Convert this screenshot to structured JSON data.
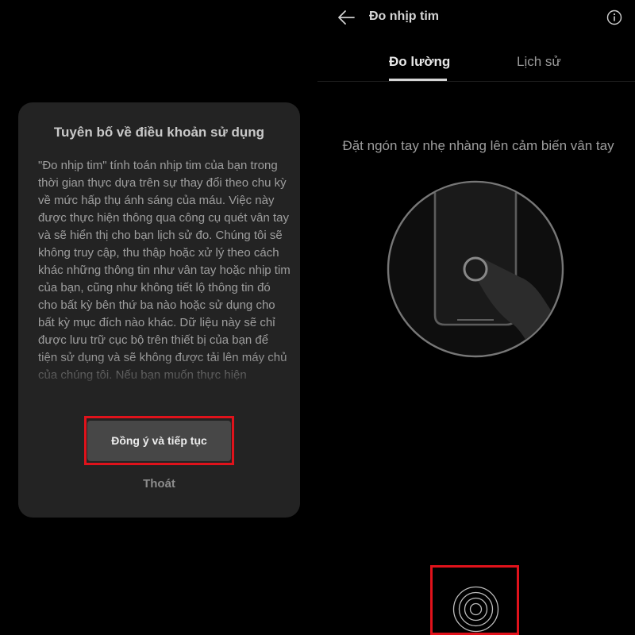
{
  "dialog": {
    "title": "Tuyên bố về điều khoản sử dụng",
    "body": "\"Đo nhịp tim\" tính toán nhịp tim của bạn trong thời gian thực dựa trên sự thay đổi theo chu kỳ về mức hấp thụ ánh sáng của máu. Việc này được thực hiện thông qua công cụ quét vân tay và sẽ hiển thị cho bạn lịch sử đo. Chúng tôi sẽ không truy cập, thu thập hoặc xử lý theo cách khác những thông tin như vân tay hoặc nhịp tim của bạn, cũng như không tiết lộ thông tin đó cho bất kỳ bên thứ ba nào hoặc sử dụng cho bất kỳ mục đích nào khác. Dữ liệu này sẽ chỉ được lưu trữ cục bộ trên thiết bị của bạn để tiện sử dụng và sẽ không được tải lên máy chủ của chúng tôi. Nếu bạn muốn thực hiện",
    "agree_label": "Đồng ý và tiếp tục",
    "exit_label": "Thoát"
  },
  "screen": {
    "title": "Đo nhịp tim",
    "tabs": [
      {
        "label": "Đo lường",
        "active": true
      },
      {
        "label": "Lịch sử",
        "active": false
      }
    ],
    "instruction": "Đặt ngón tay nhẹ nhàng lên cảm biến vân tay"
  },
  "icons": {
    "back": "arrow-left-icon",
    "info": "info-icon",
    "illustration": "finger-on-phone-sensor-icon",
    "sensor": "fingerprint-sensor-icon"
  },
  "colors": {
    "background": "#000000",
    "dialog": "#232323",
    "button": "#474747",
    "highlight": "#e0121b"
  }
}
